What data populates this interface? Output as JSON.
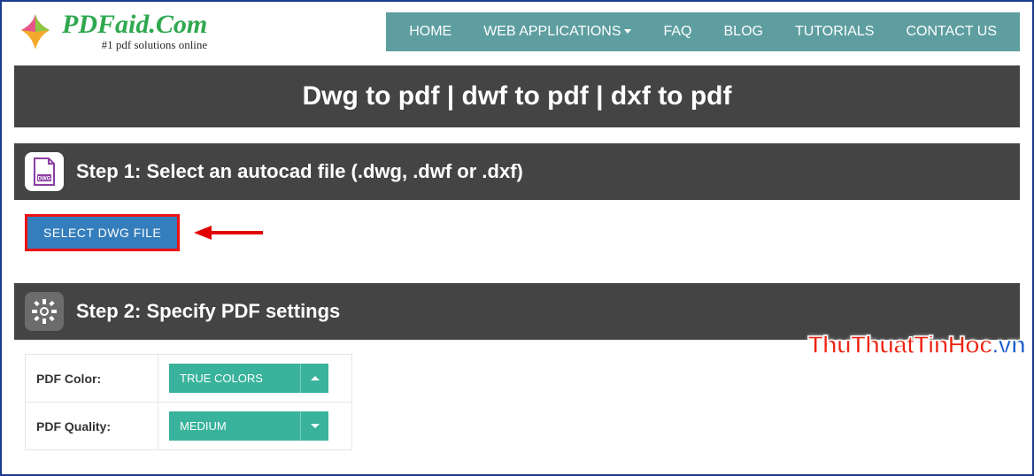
{
  "brand": {
    "name": "PDFaid.Com",
    "tagline": "#1 pdf solutions online"
  },
  "nav": {
    "home": "HOME",
    "webapps": "WEB APPLICATIONS",
    "faq": "FAQ",
    "blog": "BLOG",
    "tutorials": "TUTORIALS",
    "contact": "CONTACT US"
  },
  "page_title": "Dwg to pdf | dwf to pdf | dxf to pdf",
  "step1": {
    "heading": "Step 1: Select an autocad file (.dwg, .dwf or .dxf)",
    "button": "SELECT DWG FILE"
  },
  "step2": {
    "heading": "Step 2: Specify PDF settings",
    "color_label": "PDF Color:",
    "color_value": "TRUE COLORS",
    "quality_label": "PDF Quality:",
    "quality_value": "MEDIUM"
  },
  "watermark": {
    "a": "ThuThuatTinHoc",
    "b": ".vn"
  }
}
